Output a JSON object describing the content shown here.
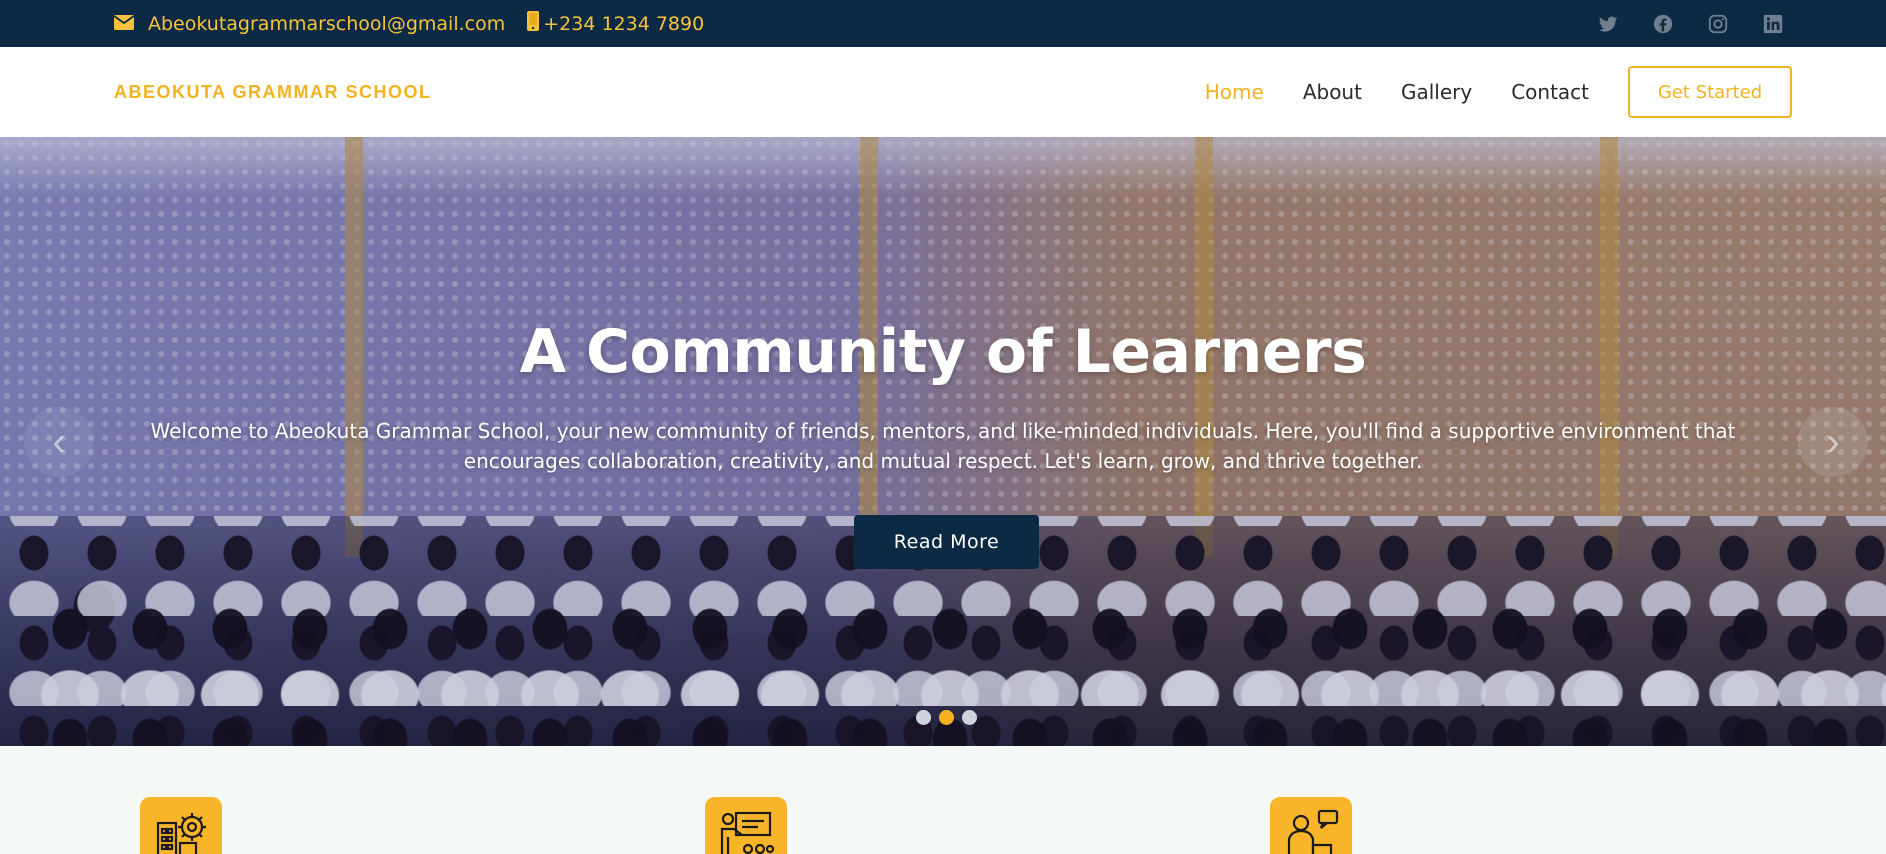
{
  "topbar": {
    "email": "Abeokutagrammarschool@gmail.com",
    "phone": "+234 1234 7890",
    "social": [
      "twitter-icon",
      "facebook-icon",
      "instagram-icon",
      "linkedin-icon"
    ]
  },
  "header": {
    "logo": "ABEOKUTA GRAMMAR SCHOOL",
    "nav": {
      "home": "Home",
      "about": "About",
      "gallery": "Gallery",
      "contact": "Contact"
    },
    "cta": "Get Started"
  },
  "hero": {
    "title": "A Community of Learners",
    "text": "Welcome to Abeokuta Grammar School, your new community of friends, mentors, and like-minded individuals. Here, you'll find a supportive environment that encourages collaboration, creativity, and mutual respect. Let's learn, grow, and thrive together.",
    "button": "Read More",
    "active_slide": 2,
    "slide_count": 3
  },
  "features": {
    "icons": [
      "school-building-gear-icon",
      "teacher-board-icon",
      "mentor-chat-icon"
    ]
  },
  "colors": {
    "navy": "#0c2a43",
    "accent": "#f5b21f",
    "white": "#ffffff"
  }
}
